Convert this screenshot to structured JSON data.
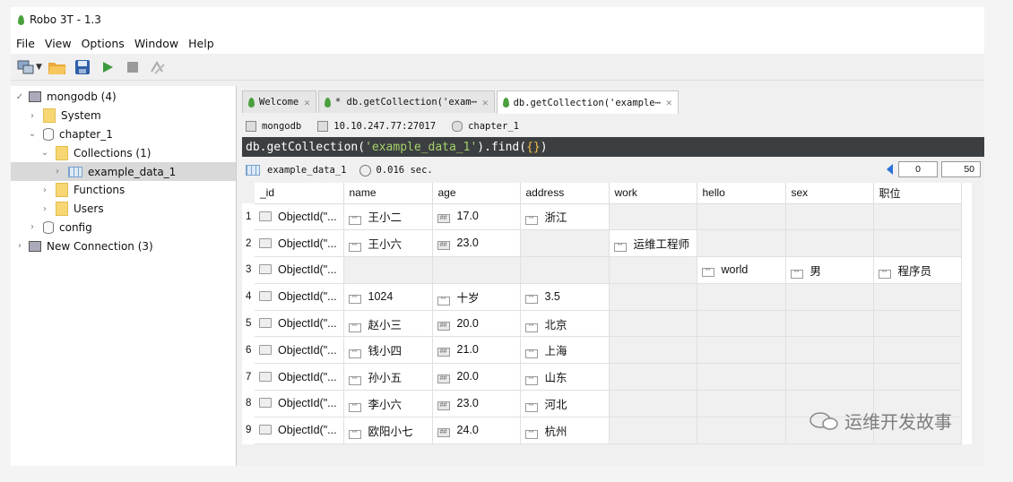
{
  "window": {
    "title": "Robo 3T - 1.3"
  },
  "menu": [
    "File",
    "View",
    "Options",
    "Window",
    "Help"
  ],
  "tree": {
    "root": "mongodb (4)",
    "system": "System",
    "db": "chapter_1",
    "collections": "Collections (1)",
    "collection": "example_data_1",
    "functions": "Functions",
    "users": "Users",
    "config": "config",
    "new_connection": "New Connection (3)"
  },
  "tabs": [
    {
      "label": "Welcome"
    },
    {
      "label": "* db.getCollection('exam⋯"
    },
    {
      "label": "db.getCollection('example⋯"
    }
  ],
  "info": {
    "server": "mongodb",
    "host": "10.10.247.77:27017",
    "database": "chapter_1"
  },
  "query": {
    "prefix": "db.getCollection(",
    "arg": "'example_data_1'",
    "middle": ").find(",
    "braces": "{}",
    "suffix": ")"
  },
  "results": {
    "collection": "example_data_1",
    "time": "0.016 sec.",
    "page_start": "0",
    "page_size": "50"
  },
  "columns": [
    "_id",
    "name",
    "age",
    "address",
    "work",
    "hello",
    "sex",
    "职位"
  ],
  "rows": [
    {
      "n": "1",
      "id": "ObjectId(\"...",
      "name": "王小二",
      "age": "17.0",
      "address": "浙江",
      "work": "",
      "hello": "",
      "sex": "",
      "pos": ""
    },
    {
      "n": "2",
      "id": "ObjectId(\"...",
      "name": "王小六",
      "age": "23.0",
      "address": "",
      "work": "运维工程师",
      "hello": "",
      "sex": "",
      "pos": ""
    },
    {
      "n": "3",
      "id": "ObjectId(\"...",
      "name": "",
      "age": "",
      "address": "",
      "work": "",
      "hello": "world",
      "sex": "男",
      "pos": "程序员"
    },
    {
      "n": "4",
      "id": "ObjectId(\"...",
      "name": "1024",
      "age": "十岁",
      "address": "3.5",
      "work": "",
      "hello": "",
      "sex": "",
      "pos": ""
    },
    {
      "n": "5",
      "id": "ObjectId(\"...",
      "name": "赵小三",
      "age": "20.0",
      "address": "北京",
      "work": "",
      "hello": "",
      "sex": "",
      "pos": ""
    },
    {
      "n": "6",
      "id": "ObjectId(\"...",
      "name": "钱小四",
      "age": "21.0",
      "address": "上海",
      "work": "",
      "hello": "",
      "sex": "",
      "pos": ""
    },
    {
      "n": "7",
      "id": "ObjectId(\"...",
      "name": "孙小五",
      "age": "20.0",
      "address": "山东",
      "work": "",
      "hello": "",
      "sex": "",
      "pos": ""
    },
    {
      "n": "8",
      "id": "ObjectId(\"...",
      "name": "李小六",
      "age": "23.0",
      "address": "河北",
      "work": "",
      "hello": "",
      "sex": "",
      "pos": ""
    },
    {
      "n": "9",
      "id": "ObjectId(\"...",
      "name": "欧阳小七",
      "age": "24.0",
      "address": "杭州",
      "work": "",
      "hello": "",
      "sex": "",
      "pos": ""
    }
  ],
  "string_types": {
    "name": [
      "s",
      "s",
      "",
      "s",
      "s",
      "s",
      "s",
      "s",
      "s"
    ],
    "age": [
      "n",
      "n",
      "",
      "s",
      "n",
      "n",
      "n",
      "n",
      "n"
    ]
  },
  "watermark": "运维开发故事",
  "colors": {
    "query_bg": "#3c3f41",
    "string": "#a5d06b",
    "accent": "#2a6fdb",
    "leaf": "#4aa03c"
  }
}
